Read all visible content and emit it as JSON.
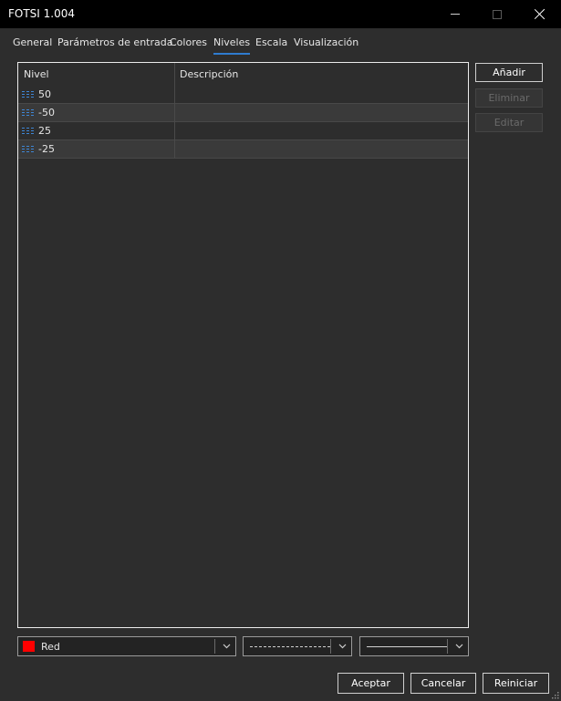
{
  "window": {
    "title": "FOTSI 1.004"
  },
  "tabs": [
    {
      "label": "General"
    },
    {
      "label": "Parámetros de entrada"
    },
    {
      "label": "Colores"
    },
    {
      "label": "Niveles"
    },
    {
      "label": "Escala"
    },
    {
      "label": "Visualización"
    }
  ],
  "active_tab": "Niveles",
  "levels_table": {
    "columns": [
      "Nivel",
      "Descripción"
    ],
    "rows": [
      {
        "level": "50",
        "description": ""
      },
      {
        "level": "-50",
        "description": ""
      },
      {
        "level": "25",
        "description": ""
      },
      {
        "level": "-25",
        "description": ""
      }
    ]
  },
  "side_buttons": {
    "add": "Añadir",
    "remove": "Eliminar",
    "edit": "Editar"
  },
  "style_controls": {
    "color_name": "Red",
    "color_value": "#ff0000",
    "line_style": "dashed",
    "line_width": "thin"
  },
  "footer_buttons": {
    "accept": "Aceptar",
    "cancel": "Cancelar",
    "reset": "Reiniciar"
  },
  "colors": {
    "background": "#2d2d2d",
    "titlebar": "#000000",
    "accent": "#2f7ccf"
  }
}
